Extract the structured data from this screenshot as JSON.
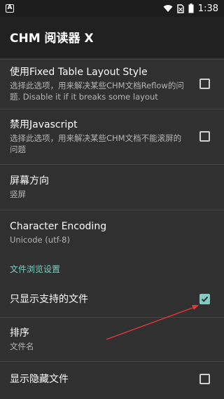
{
  "status_bar": {
    "left_icon": "A",
    "time": "1:38"
  },
  "app_bar": {
    "title": "CHM 阅读器 X"
  },
  "settings": [
    {
      "title": "使用Fixed Table Layout Style",
      "summary": "选择此选项，用来解决某些CHM文档Reflow的问题. Disable it if it breaks some layout",
      "checked": false
    },
    {
      "title": "禁用Javascript",
      "summary": "选择此选项，用来解决某些CHM文档不能滚屏的问题",
      "checked": false
    },
    {
      "title": "屏幕方向",
      "summary": "竖屏"
    },
    {
      "title": "Character Encoding",
      "summary": "Unicode (utf-8)"
    }
  ],
  "category": {
    "label": "文件浏览设置"
  },
  "file_settings": [
    {
      "title": "只显示支持的文件",
      "checked": true
    },
    {
      "title": "排序",
      "summary": "文件名"
    },
    {
      "title": "显示隐藏文件",
      "checked": false
    }
  ],
  "colors": {
    "accent": "#80cbc4",
    "annotation_arrow": "#e53935",
    "background": "#303030",
    "app_bar": "#212121"
  }
}
